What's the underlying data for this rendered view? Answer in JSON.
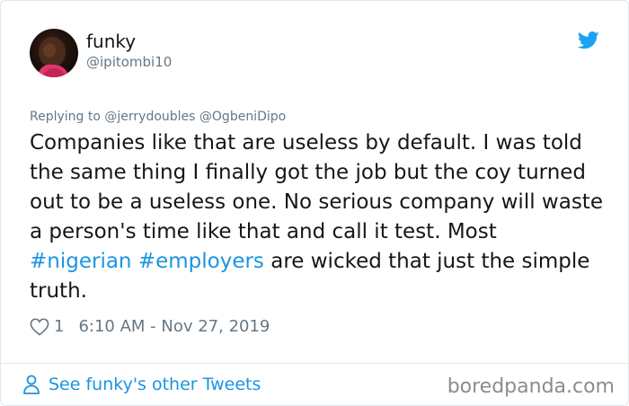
{
  "user": {
    "display_name": "funky",
    "handle": "@ipitombi10"
  },
  "reply": {
    "prefix": "Replying to",
    "mentions": [
      "@jerrydoubles",
      "@OgbeniDipo"
    ]
  },
  "tweet": {
    "text_before": "Companies like that are useless by default. I was told the same thing I finally got the job but the coy turned out to be a useless one. No serious company will waste a person's time like that and call it test. Most",
    "hashtags": [
      "#nigerian",
      "#employers"
    ],
    "text_after": "are wicked that just the simple truth."
  },
  "meta": {
    "like_count": "1",
    "timestamp": "6:10 AM - Nov 27, 2019"
  },
  "footer": {
    "see_more": "See funky's other Tweets",
    "watermark": "boredpanda.com"
  },
  "icons": {
    "brand": "twitter-bird-icon",
    "like": "heart-icon",
    "profile": "person-icon"
  },
  "colors": {
    "link": "#1b95e0",
    "muted": "#657786",
    "text": "#14171a",
    "twitter_blue": "#1da1f2"
  }
}
